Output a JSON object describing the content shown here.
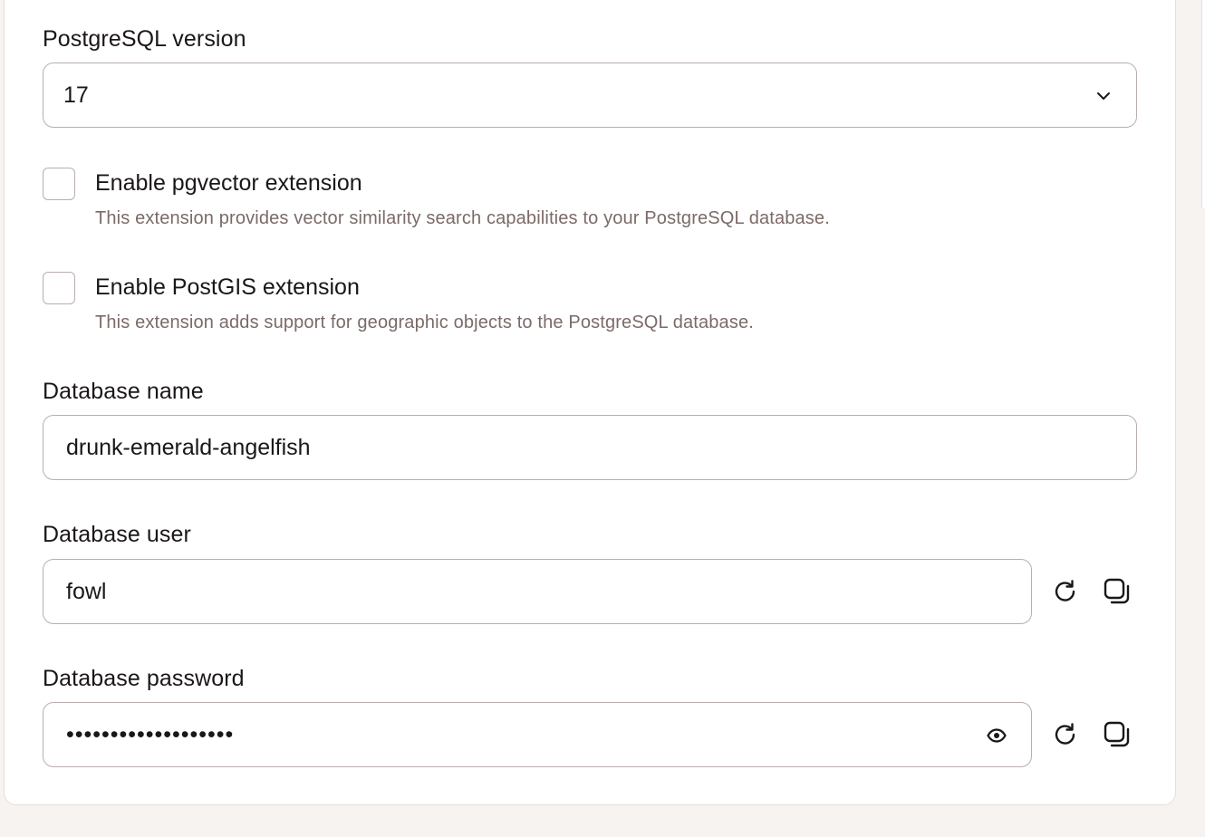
{
  "form": {
    "version": {
      "label": "PostgreSQL version",
      "selected": "17"
    },
    "pgvector": {
      "label": "Enable pgvector extension",
      "description": "This extension provides vector similarity search capabilities to your PostgreSQL database.",
      "checked": false
    },
    "postgis": {
      "label": "Enable PostGIS extension",
      "description": "This extension adds support for geographic objects to the PostgreSQL database.",
      "checked": false
    },
    "db_name": {
      "label": "Database name",
      "value": "drunk-emerald-angelfish"
    },
    "db_user": {
      "label": "Database user",
      "value": "fowl"
    },
    "db_password": {
      "label": "Database password",
      "masked_value": "•••••••••••••••••••"
    }
  },
  "icons": {
    "dropdown": "chevron-down-icon",
    "regenerate": "refresh-icon",
    "copy": "copy-icon",
    "reveal": "eye-icon"
  },
  "colors": {
    "background": "#f7f3f1",
    "border": "#b9aeac",
    "muted_text": "#7b6a68"
  }
}
